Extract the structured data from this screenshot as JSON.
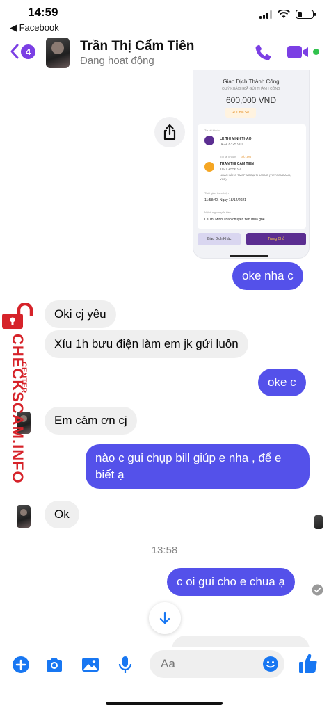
{
  "status_bar": {
    "time": "14:59",
    "back_app": "◀ Facebook"
  },
  "header": {
    "unread_count": "4",
    "contact_name": "Trần Thị Cẩm Tiên",
    "contact_status": "Đang hoạt động",
    "accent_color": "#7b3fe4"
  },
  "receipt": {
    "title": "Giao Dịch Thành Công",
    "subtitle": "QUÝ KHÁCH ĐÃ GỬI THÀNH CÔNG",
    "amount": "600,000 VND",
    "share_label": "Chia Sẻ",
    "from_label": "Từ tài khoản",
    "from_name": "LE THI MINH THAO",
    "from_account": "0424 8325 901",
    "to_label": "Tới tài khoản",
    "to_saved": "ĐÃ LƯU",
    "to_name": "TRAN THI CAM TIEN",
    "to_account": "1021 4556 92",
    "to_bank": "NGÂN HÀNG TMCP NGOẠI THƯƠNG (VIETCOMBANK, VCB)",
    "time_label": "Thời gian thực hiện",
    "time_value": "11:58:40, Ngày 18/12/2021",
    "content_label": "Nội dung chuyển tiền",
    "content_value": "Le Thi Minh Thao chuyen tien mua ghe",
    "other_button": "Giao Dịch Khác",
    "home_button": "Trang Chủ"
  },
  "messages": [
    {
      "side": "out",
      "text": "oke nha c"
    },
    {
      "side": "in",
      "text": "Oki cj yêu"
    },
    {
      "side": "in",
      "text": "Xíu 1h bưu điện làm em jk gửi luôn"
    },
    {
      "side": "out",
      "text": "oke c"
    },
    {
      "side": "in",
      "text": "Em cám ơn cj"
    },
    {
      "side": "out",
      "text": "nào c gui chụp bill giúp e nha , để e biết ạ"
    },
    {
      "side": "in",
      "text": "Ok"
    },
    {
      "side": "out",
      "text": "c oi gui cho e chua ạ"
    }
  ],
  "time_separator": "13:58",
  "watermark": {
    "brand": "CHECKSCAM.INFO",
    "center": "CENTER"
  },
  "composer": {
    "placeholder": "Aa"
  },
  "colors": {
    "outgoing_bubble": "#5451ea",
    "incoming_bubble": "#efefef",
    "icon_blue": "#1877f2"
  }
}
